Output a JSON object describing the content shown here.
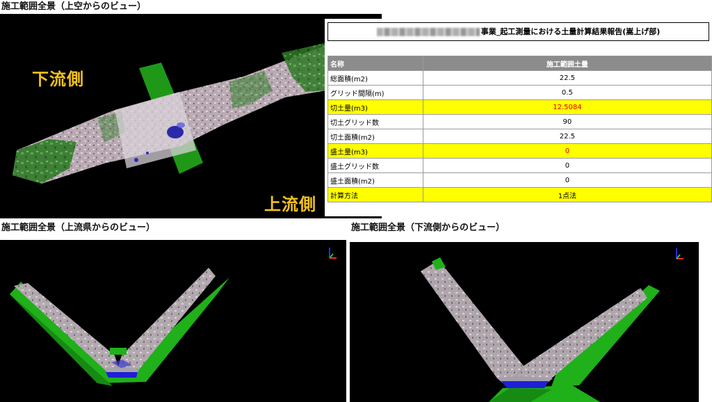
{
  "top_view": {
    "caption": "施工範囲全景（上空からのビュー）",
    "label_downstream": "下流側",
    "label_upstream": "上流側"
  },
  "report": {
    "title": "事業_起工測量における土量計算結果報告(嵩上げ部)",
    "header": [
      "名称",
      "施工範囲土量"
    ],
    "rows": [
      {
        "name": "総面積(m2)",
        "value": "22.5",
        "highlight": false,
        "value_color": ""
      },
      {
        "name": "グリッド間隔(m)",
        "value": "0.5",
        "highlight": false,
        "value_color": ""
      },
      {
        "name": "切土量(m3)",
        "value": "12.5084",
        "highlight": true,
        "value_color": "#e00000"
      },
      {
        "name": "切土グリッド数",
        "value": "90",
        "highlight": false,
        "value_color": ""
      },
      {
        "name": "切土面積(m2)",
        "value": "22.5",
        "highlight": false,
        "value_color": ""
      },
      {
        "name": "盛土量(m3)",
        "value": "0",
        "highlight": true,
        "value_color": "#e00000"
      },
      {
        "name": "盛土グリッド数",
        "value": "0",
        "highlight": false,
        "value_color": ""
      },
      {
        "name": "盛土面積(m2)",
        "value": "0",
        "highlight": false,
        "value_color": ""
      },
      {
        "name": "計算方法",
        "value": "1点法",
        "highlight": true,
        "value_color": ""
      }
    ]
  },
  "upstream_view": {
    "caption": "施工範囲全景（上流県からのビュー）"
  },
  "downstream_view": {
    "caption": "施工範囲全景（下流側からのビュー）"
  },
  "colors": {
    "highlight": "#ffff00",
    "header_bg": "#8c8c8c",
    "label_gold": "#f3c21a",
    "vegetation_green": "#2e7d22",
    "excavation_green": "#22b81c",
    "water_blue": "#1e1ec8"
  }
}
